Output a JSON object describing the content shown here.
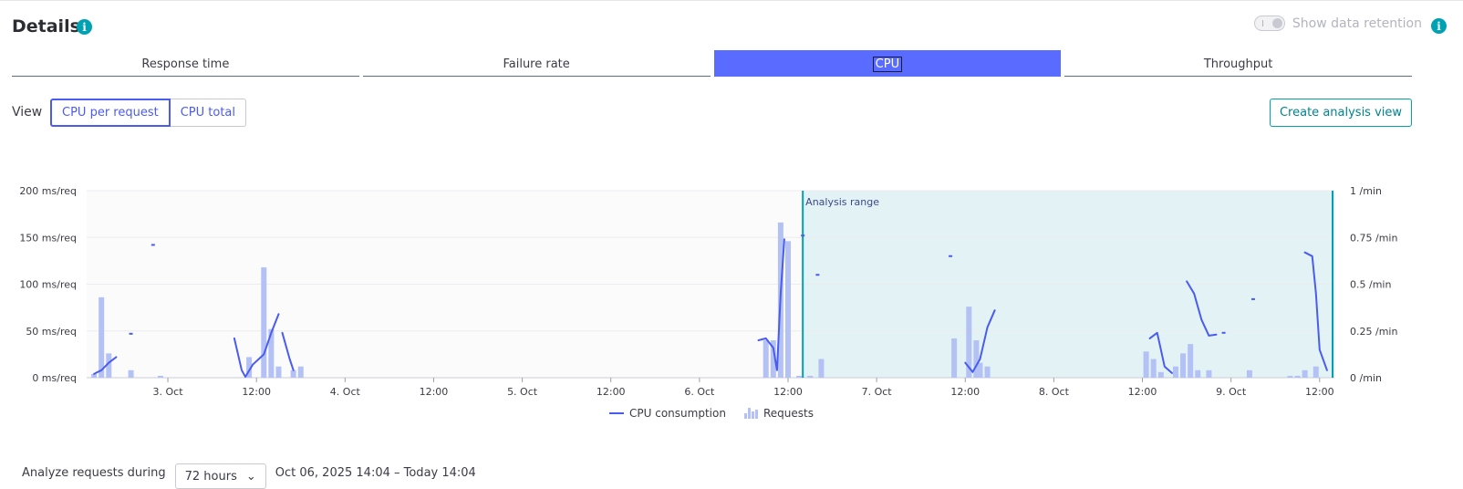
{
  "header": {
    "title": "Details",
    "retention_label": "Show data retention"
  },
  "tabs": [
    {
      "label": "Response time",
      "active": false
    },
    {
      "label": "Failure rate",
      "active": false
    },
    {
      "label": "CPU",
      "active": true
    },
    {
      "label": "Throughput",
      "active": false
    }
  ],
  "view": {
    "label": "View",
    "options": [
      "CPU per request",
      "CPU total"
    ],
    "selected": "CPU per request"
  },
  "actions": {
    "create_analysis": "Create analysis view"
  },
  "colors": {
    "accent": "#5a6cff",
    "line": "#4a5cf0",
    "bars": "#b4c1f5",
    "analysis_bg": "#e3f2f5",
    "analysis_border": "#00a1b2"
  },
  "chart_data": {
    "type": "line",
    "x_unit": "hours since 2 Oct 00:00",
    "x_ticks": [
      {
        "x": 24,
        "label": "3. Oct"
      },
      {
        "x": 36,
        "label": "12:00"
      },
      {
        "x": 48,
        "label": "4. Oct"
      },
      {
        "x": 60,
        "label": "12:00"
      },
      {
        "x": 72,
        "label": "5. Oct"
      },
      {
        "x": 84,
        "label": "12:00"
      },
      {
        "x": 96,
        "label": "6. Oct"
      },
      {
        "x": 108,
        "label": "12:00"
      },
      {
        "x": 120,
        "label": "7. Oct"
      },
      {
        "x": 132,
        "label": "12:00"
      },
      {
        "x": 144,
        "label": "8. Oct"
      },
      {
        "x": 156,
        "label": "12:00"
      },
      {
        "x": 168,
        "label": "9. Oct"
      },
      {
        "x": 180,
        "label": "12:00"
      }
    ],
    "xlim": [
      13,
      182
    ],
    "y_left": {
      "unit": "ms/req",
      "lim": [
        0,
        200
      ],
      "ticks": [
        "0 ms/req",
        "50 ms/req",
        "100 ms/req",
        "150 ms/req",
        "200 ms/req"
      ]
    },
    "y_right": {
      "unit": "/min",
      "lim": [
        0,
        1
      ],
      "ticks": [
        "0 /min",
        "0.25 /min",
        "0.5 /min",
        "0.75 /min",
        "1 /min"
      ]
    },
    "analysis_range": {
      "label": "Analysis range",
      "start": 110,
      "end": 182
    },
    "legend": [
      "CPU consumption",
      "Requests"
    ],
    "series": [
      {
        "name": "CPU consumption",
        "axis": "left",
        "segments": [
          [
            [
              14.0,
              4
            ],
            [
              14.5,
              6
            ],
            [
              15.0,
              8
            ],
            [
              16.0,
              16
            ],
            [
              17.0,
              22
            ]
          ],
          [
            [
              33.0,
              42
            ],
            [
              34.0,
              8
            ],
            [
              34.5,
              1
            ],
            [
              35.5,
              14
            ],
            [
              37.0,
              25
            ],
            [
              38.0,
              48
            ],
            [
              39.0,
              68
            ]
          ],
          [
            [
              39.5,
              48
            ],
            [
              40.5,
              20
            ],
            [
              41.0,
              8
            ]
          ],
          [
            [
              104.0,
              40
            ],
            [
              105.0,
              42
            ],
            [
              106.0,
              32
            ],
            [
              106.5,
              8
            ],
            [
              107.0,
              90
            ],
            [
              107.5,
              148
            ]
          ],
          [
            [
              132.0,
              16
            ],
            [
              133.0,
              6
            ],
            [
              134.0,
              20
            ],
            [
              135.0,
              54
            ],
            [
              136.0,
              72
            ]
          ],
          [
            [
              157.0,
              42
            ],
            [
              158.0,
              48
            ],
            [
              158.5,
              30
            ],
            [
              159.0,
              12
            ],
            [
              160.0,
              5
            ]
          ],
          [
            [
              162.0,
              103
            ],
            [
              163.0,
              90
            ],
            [
              164.0,
              62
            ],
            [
              165.0,
              45
            ],
            [
              166.0,
              46
            ]
          ],
          [
            [
              178.0,
              134
            ],
            [
              179.0,
              130
            ],
            [
              179.5,
              90
            ],
            [
              180.0,
              30
            ],
            [
              181.0,
              8
            ]
          ]
        ],
        "points": [
          [
            19.0,
            47
          ],
          [
            22.0,
            142
          ],
          [
            110.0,
            152
          ],
          [
            112.0,
            110
          ],
          [
            130.0,
            130
          ],
          [
            167.0,
            48
          ],
          [
            171.0,
            84
          ]
        ]
      },
      {
        "name": "Requests",
        "axis": "right",
        "type": "bar",
        "values": [
          [
            14.0,
            0.02
          ],
          [
            15.0,
            0.43
          ],
          [
            16.0,
            0.13
          ],
          [
            19.0,
            0.04
          ],
          [
            23.0,
            0.01
          ],
          [
            35.0,
            0.11
          ],
          [
            37.0,
            0.59
          ],
          [
            38.0,
            0.26
          ],
          [
            39.0,
            0.06
          ],
          [
            41.0,
            0.04
          ],
          [
            42.0,
            0.06
          ],
          [
            105.0,
            0.2
          ],
          [
            106.0,
            0.2
          ],
          [
            107.0,
            0.83
          ],
          [
            108.0,
            0.73
          ],
          [
            109.5,
            0.01
          ],
          [
            111.0,
            0.01
          ],
          [
            112.5,
            0.1
          ],
          [
            130.5,
            0.21
          ],
          [
            132.5,
            0.38
          ],
          [
            133.5,
            0.2
          ],
          [
            134.0,
            0.08
          ],
          [
            135.0,
            0.06
          ],
          [
            156.5,
            0.14
          ],
          [
            157.5,
            0.1
          ],
          [
            158.5,
            0.03
          ],
          [
            160.5,
            0.06
          ],
          [
            161.5,
            0.13
          ],
          [
            162.5,
            0.18
          ],
          [
            163.5,
            0.04
          ],
          [
            165.0,
            0.04
          ],
          [
            170.5,
            0.04
          ],
          [
            176.0,
            0.01
          ],
          [
            177.0,
            0.01
          ],
          [
            178.0,
            0.04
          ],
          [
            179.5,
            0.06
          ]
        ]
      }
    ]
  },
  "footer": {
    "analyze_label": "Analyze requests during",
    "period": "72 hours",
    "range": "Oct 06, 2025 14:04 – Today 14:04"
  }
}
